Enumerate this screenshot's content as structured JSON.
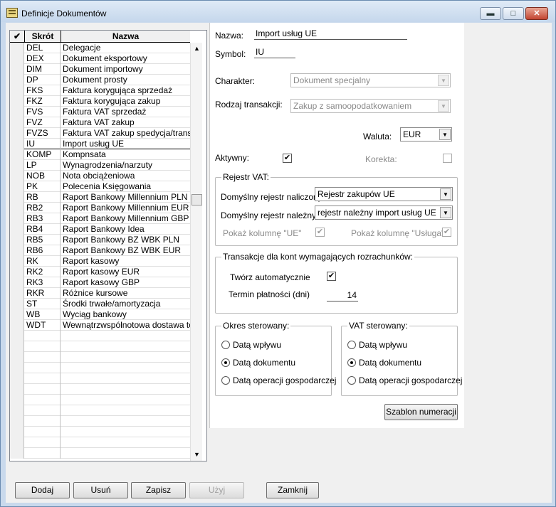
{
  "window": {
    "title": "Definicje Dokumentów",
    "min_glyph": "▬",
    "max_glyph": "□",
    "close_glyph": "✕"
  },
  "grid": {
    "columns": [
      "✔",
      "Skrót",
      "Nazwa"
    ],
    "rows": [
      {
        "code": "DEL",
        "name": "Delegacje"
      },
      {
        "code": "DEX",
        "name": "Dokument eksportowy"
      },
      {
        "code": "DIM",
        "name": "Dokument importowy"
      },
      {
        "code": "DP",
        "name": "Dokument prosty"
      },
      {
        "code": "FKS",
        "name": "Faktura korygująca sprzedaż"
      },
      {
        "code": "FKZ",
        "name": "Faktura korygująca zakup"
      },
      {
        "code": "FVS",
        "name": "Faktura VAT sprzedaż"
      },
      {
        "code": "FVZ",
        "name": "Faktura VAT zakup"
      },
      {
        "code": "FVZS",
        "name": "Faktura VAT zakup spedycja/transpo"
      },
      {
        "code": "IU",
        "name": "Import usług UE"
      },
      {
        "code": "KOMP",
        "name": "Kompnsata"
      },
      {
        "code": "LP",
        "name": "Wynagrodzenia/narzuty"
      },
      {
        "code": "NOB",
        "name": "Nota obciążeniowa"
      },
      {
        "code": "PK",
        "name": "Polecenia Księgowania"
      },
      {
        "code": "RB",
        "name": "Raport Bankowy Millennium PLN"
      },
      {
        "code": "RB2",
        "name": "Raport Bankowy Millennium EUR"
      },
      {
        "code": "RB3",
        "name": "Raport Bankowy Millennium GBP"
      },
      {
        "code": "RB4",
        "name": "Raport Bankowy Idea"
      },
      {
        "code": "RB5",
        "name": "Raport Bankowy BZ WBK PLN"
      },
      {
        "code": "RB6",
        "name": "Raport Bankowy BZ WBK EUR"
      },
      {
        "code": "RK",
        "name": "Raport kasowy"
      },
      {
        "code": "RK2",
        "name": "Raport kasowy EUR"
      },
      {
        "code": "RK3",
        "name": "Raport kasowy GBP"
      },
      {
        "code": "RKR",
        "name": "Różnice kursowe"
      },
      {
        "code": "ST",
        "name": "Środki trwałe/amortyzacja"
      },
      {
        "code": "WB",
        "name": "Wyciąg bankowy"
      },
      {
        "code": "WDT",
        "name": "Wewnątrzwspólnotowa dostawa tow"
      }
    ],
    "selected_code": "IU",
    "empty_rows": 12,
    "scroll_up": "▲",
    "scroll_down": "▼"
  },
  "form": {
    "nazwa_label": "Nazwa:",
    "nazwa_value": "Import usług UE",
    "symbol_label": "Symbol:",
    "symbol_value": "IU",
    "charakter_label": "Charakter:",
    "charakter_value": "Dokument specjalny",
    "rodzaj_label": "Rodzaj transakcji:",
    "rodzaj_value": "Zakup z samoopodatkowaniem",
    "waluta_label": "Waluta:",
    "waluta_value": "EUR",
    "aktywny_label": "Aktywny:",
    "aktywny_checked": true,
    "korekta_label": "Korekta:",
    "korekta_checked": false,
    "combo_arrow": "▼",
    "check_glyph": "✔"
  },
  "vat_register": {
    "title": "Rejestr VAT:",
    "naliczony_label": "Domyślny rejestr naliczony:",
    "naliczony_value": "Rejestr zakupów UE",
    "nalezny_label": "Domyślny rejestr należny:",
    "nalezny_value": "rejestr należny import usług UE",
    "show_ue_label": "Pokaż kolumnę \"UE\"",
    "show_ue_checked": true,
    "show_usluga_label": "Pokaż kolumnę \"Usługa\"",
    "show_usluga_checked": true
  },
  "settlement": {
    "title": "Transakcje dla kont wymagających rozrachunków:",
    "auto_label": "Twórz automatycznie",
    "auto_checked": true,
    "term_label": "Termin płatności (dni)",
    "term_value": "14"
  },
  "okres": {
    "title": "Okres sterowany:",
    "options": [
      "Datą wpływu",
      "Datą dokumentu",
      "Datą operacji gospodarczej"
    ],
    "selected_index": 1
  },
  "vat_sterowany": {
    "title": "VAT sterowany:",
    "options": [
      "Datą wpływu",
      "Datą dokumentu",
      "Datą operacji gospodarczej"
    ],
    "selected_index": 1
  },
  "numbering_button": "Szablon numeracji",
  "buttons": {
    "add": "Dodaj",
    "delete": "Usuń",
    "save": "Zapisz",
    "use": "Użyj",
    "close": "Zamknij"
  }
}
